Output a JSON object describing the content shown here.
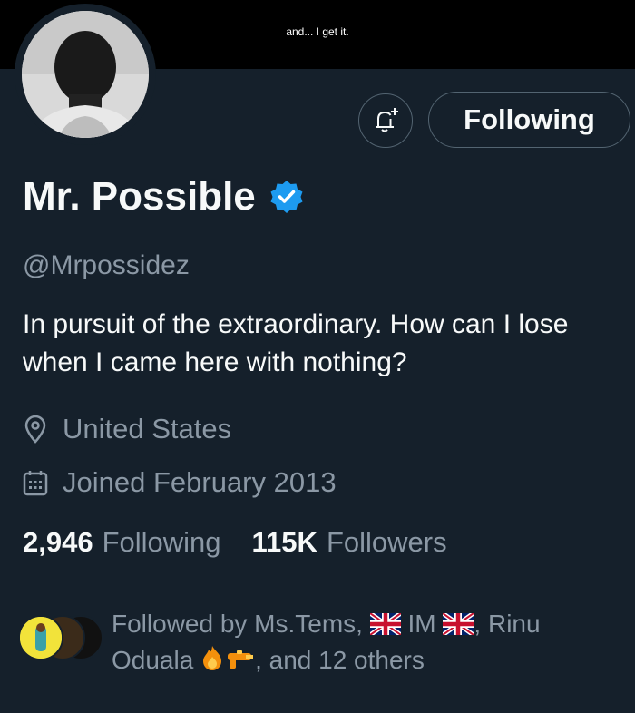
{
  "banner": {
    "text": "and... I get it."
  },
  "actions": {
    "following_label": "Following"
  },
  "profile": {
    "name": "Mr. Possible",
    "handle": "@Mrpossidez",
    "bio": "In pursuit of the extraordinary. How can I lose when I came here with nothing?",
    "location": "United States",
    "joined": "Joined February 2013"
  },
  "stats": {
    "following_count": "2,946",
    "following_label": "Following",
    "followers_count": "115K",
    "followers_label": "Followers"
  },
  "followed_by": {
    "prefix": "Followed by Ms.Tems,",
    "name2": "IM",
    "name3_part1": "Rinu",
    "name3_part2": "Oduala",
    "suffix": ", and 12 others"
  },
  "colors": {
    "background": "#15202b",
    "banner": "#000000",
    "text_primary": "#f7f9f9",
    "text_secondary": "#8b98a5",
    "verified_blue": "#1d9bf0",
    "border": "#536471"
  },
  "icons": [
    "bell-plus-icon",
    "verified-badge-icon",
    "location-pin-icon",
    "calendar-icon",
    "uk-flag-icon",
    "fire-emoji",
    "water-gun-emoji"
  ]
}
